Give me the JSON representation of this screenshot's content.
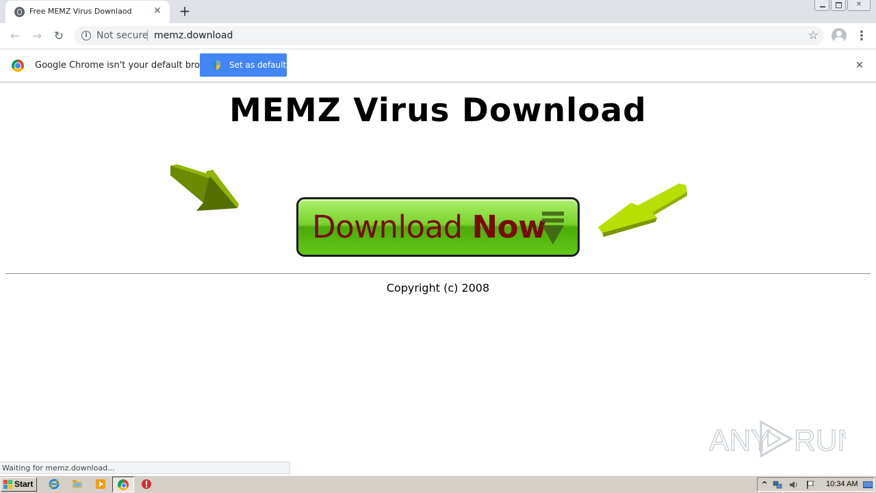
{
  "browser": {
    "tab_title": "Free MEMZ Virus Downlaod",
    "tab_close": "✕",
    "new_tab": "+",
    "security_label": "Not secure",
    "url": "memz.download",
    "back": "←",
    "forward": "→",
    "reload": "↻",
    "bookmark": "☆",
    "menu": "⋮"
  },
  "infobar": {
    "message": "Google Chrome isn't your default browser",
    "button_label": "Set as default",
    "close": "✕"
  },
  "page": {
    "title": "MEMZ Virus Download",
    "download_button": {
      "word1": "Download",
      "word2": "Now"
    },
    "copyright": "Copyright (c) 2008"
  },
  "status_bar": {
    "text": "Waiting for memz.download..."
  },
  "watermark": {
    "text": "ANY RUN"
  },
  "taskbar": {
    "start_label": "Start",
    "clock": "10:34 AM",
    "tray_expand": "^"
  },
  "colors": {
    "button_green": "#6fcf1a",
    "button_text": "#7a0a0a",
    "arrow_left": "#6b8a00",
    "arrow_right": "#b7e000",
    "infobar_button": "#4285f4"
  }
}
